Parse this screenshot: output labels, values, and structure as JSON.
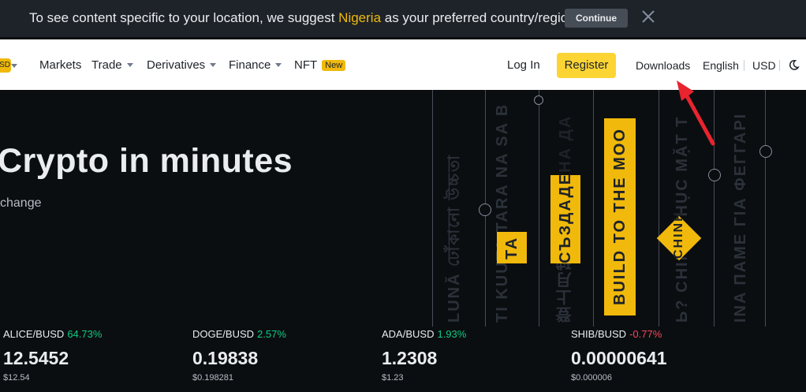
{
  "banner": {
    "text_before": "To see content specific to your location, we suggest ",
    "country": "Nigeria",
    "text_after": " as your preferred country/region.",
    "continue_label": "Continue"
  },
  "nav": {
    "left_badge": "SD",
    "items": [
      {
        "label": "Markets"
      },
      {
        "label": "Trade"
      },
      {
        "label": "Derivatives"
      },
      {
        "label": "Finance"
      },
      {
        "label": "NFT"
      }
    ],
    "nft_badge": "New",
    "login_label": "Log In",
    "register_label": "Register",
    "downloads_label": "Downloads",
    "language_label": "English",
    "currency_label": "USD"
  },
  "hero": {
    "title": "Crypto in minutes",
    "subtitle": "change"
  },
  "art": {
    "tags": [
      "TA",
      "СЪЗДАДЕНА ДА",
      "BUILD TO THE MOO",
      "CHINH"
    ],
    "background_texts": [
      "LUNĂ ঢোঁকানো উচ্চতা",
      "TI KUUTA TARA NA SA B",
      "登上月球",
      "Ь? CHINH PHỤC MẶT T",
      "INA ΠΑΜΕ ΓΙΑ ΦΕΓΓΑΡΙ"
    ]
  },
  "tickers": [
    {
      "pair": "ALICE/BUSD",
      "change": "64.73%",
      "direction": "up",
      "price": "12.5452",
      "sub_price": "$12.54"
    },
    {
      "pair": "DOGE/BUSD",
      "change": "2.57%",
      "direction": "up",
      "price": "0.19838",
      "sub_price": "$0.198281"
    },
    {
      "pair": "ADA/BUSD",
      "change": "1.93%",
      "direction": "up",
      "price": "1.2308",
      "sub_price": "$1.23"
    },
    {
      "pair": "SHIB/BUSD",
      "change": "-0.77%",
      "direction": "down",
      "price": "0.00000641",
      "sub_price": "$0.000006"
    }
  ],
  "colors": {
    "brand_yellow": "#f0b90b",
    "register_yellow": "#fcd535",
    "up_green": "#0ecb81",
    "down_red": "#f6465d",
    "arrow_red": "#e8242f",
    "background": "#0b0e11"
  },
  "icons": [
    "close-icon",
    "caret-down-icon",
    "theme-toggle-moon-icon",
    "annotation-arrow"
  ]
}
